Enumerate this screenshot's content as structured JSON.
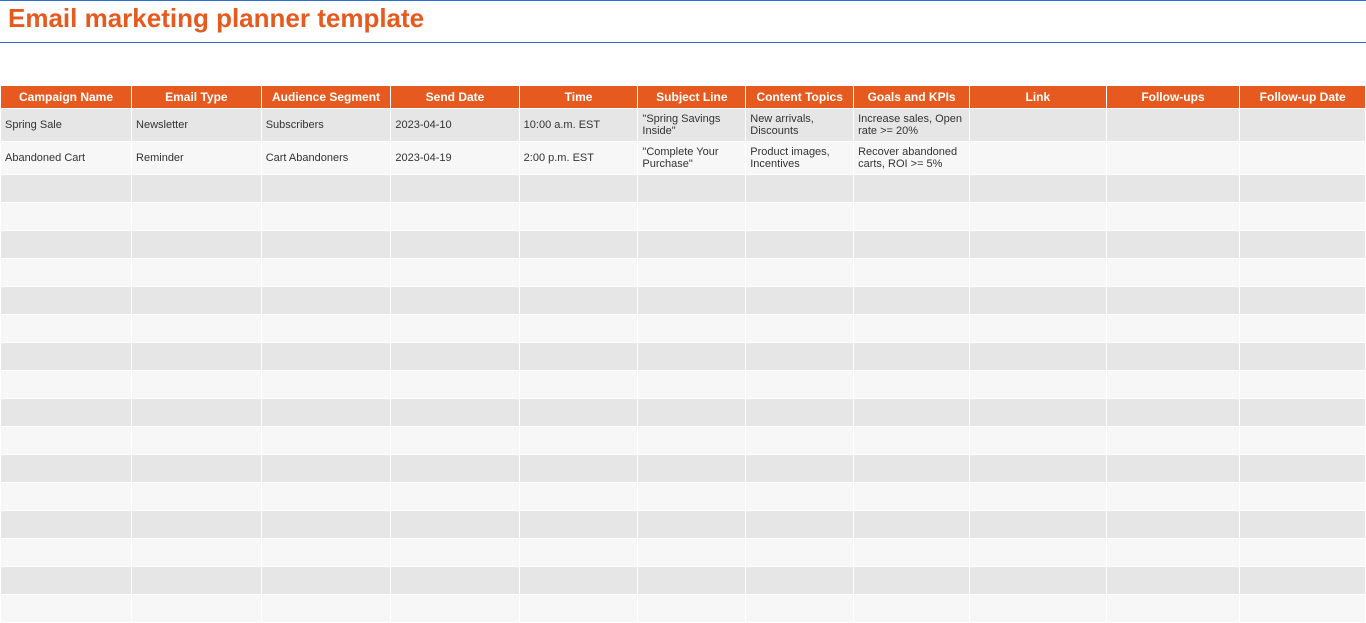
{
  "title": "Email marketing planner template",
  "colors": {
    "accent": "#e65a1f",
    "title_border": "#2a6fc9",
    "row_dark": "#e6e6e6",
    "row_light": "#f7f7f7"
  },
  "table": {
    "headers": [
      "Campaign Name",
      "Email Type",
      "Audience Segment",
      "Send Date",
      "Time",
      "Subject Line",
      "Content Topics",
      "Goals and KPIs",
      "Link",
      "Follow-ups",
      "Follow-up Date"
    ],
    "rows": [
      {
        "campaign_name": "Spring Sale",
        "email_type": "Newsletter",
        "audience_segment": "Subscribers",
        "send_date": "2023-04-10",
        "time": "10:00 a.m. EST",
        "subject_line": "\"Spring Savings Inside\"",
        "content_topics": "New arrivals, Discounts",
        "goals_kpis": "Increase sales, Open rate >= 20%",
        "link": "",
        "follow_ups": "",
        "follow_up_date": ""
      },
      {
        "campaign_name": "Abandoned Cart",
        "email_type": "Reminder",
        "audience_segment": "Cart Abandoners",
        "send_date": "2023-04-19",
        "time": "2:00 p.m. EST",
        "subject_line": "\"Complete Your Purchase\"",
        "content_topics": "Product images, Incentives",
        "goals_kpis": "Recover abandoned carts, ROI >= 5%",
        "link": "",
        "follow_ups": "",
        "follow_up_date": ""
      }
    ],
    "empty_rows": 16
  }
}
